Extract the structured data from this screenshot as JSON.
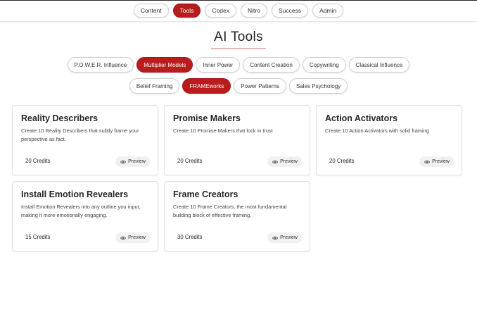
{
  "nav": {
    "items": [
      {
        "label": "Content",
        "active": false
      },
      {
        "label": "Tools",
        "active": true
      },
      {
        "label": "Codex",
        "active": false
      },
      {
        "label": "Nitro",
        "active": false
      },
      {
        "label": "Success",
        "active": false
      },
      {
        "label": "Admin",
        "active": false
      }
    ]
  },
  "page": {
    "title": "AI Tools"
  },
  "filters": {
    "row1": [
      {
        "label": "P.O.W.E.R. Influence",
        "active": false
      },
      {
        "label": "Multiplier Models",
        "active": true
      },
      {
        "label": "Inner Power",
        "active": false
      },
      {
        "label": "Content Creation",
        "active": false
      },
      {
        "label": "Copywriting",
        "active": false
      },
      {
        "label": "Classical Influence",
        "active": false
      }
    ],
    "row2": [
      {
        "label": "Belief Framing",
        "active": false
      },
      {
        "label": "FRAMEworks",
        "active": true
      },
      {
        "label": "Power Patterns",
        "active": false
      },
      {
        "label": "Sales Psychology",
        "active": false
      }
    ]
  },
  "cards": [
    {
      "title": "Reality Describers",
      "description": "Create 10 Reality Describers that subtly frame your perspective as fact.",
      "credits": "20 Credits",
      "preview": "Preview"
    },
    {
      "title": "Promise Makers",
      "description": "Create 10 Promise Makers that lock in trust",
      "credits": "20 Credits",
      "preview": "Preview"
    },
    {
      "title": "Action Activators",
      "description": "Create 10 Action Activators with solid framing",
      "credits": "20 Credits",
      "preview": "Preview"
    },
    {
      "title": "Install Emotion Revealers",
      "description": "Install Emotion Revealers into any outline you input, making it more emotionally engaging.",
      "credits": "15 Credits",
      "preview": "Preview"
    },
    {
      "title": "Frame Creators",
      "description": "Create 10 Frame Creators, the most fundamental building block of effective framing.",
      "credits": "30 Credits",
      "preview": "Preview"
    }
  ],
  "colors": {
    "accent": "#b81c1c",
    "icon": "eye-icon"
  }
}
